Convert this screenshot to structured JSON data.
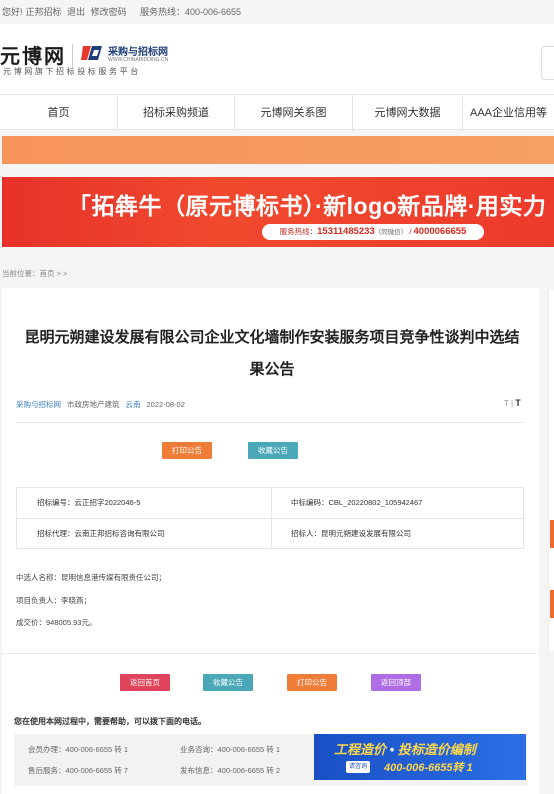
{
  "topbar": {
    "greeting": "您好!",
    "company": "正邦招标",
    "logout": "退出",
    "change_password": "修改密码",
    "hotline": "服务热线：400-006-6655"
  },
  "header": {
    "logo_text": "元博网",
    "logo_subtitle": "元博网旗下招标投标服务平台",
    "brand_name": "采购与招标网",
    "brand_url": "WWW.CHINABIDDING.CN"
  },
  "nav": {
    "items": [
      "首页",
      "招标采购频道",
      "元博网关系图",
      "元博网大数据",
      "AAA企业信用等"
    ]
  },
  "banner": {
    "title": "「拓犇牛（原元博标书）·新logo新品牌·用实力",
    "pill_prefix": "服务热线：",
    "pill_phone": "15311485233",
    "pill_note": "（同微信）",
    "pill_sep": " / ",
    "pill_phone2": "4000066655"
  },
  "breadcrumb": "当前位置：首页 > >",
  "article": {
    "title": "昆明元朔建设发展有限公司企业文化墙制作安装服务项目竞争性谈判中选结果公告",
    "category": "采购与招标网",
    "industry": "市政房地产建筑",
    "province": "云南",
    "date": "2022-08-02",
    "font_small": "T",
    "font_large": "T",
    "print_button": "打印公告",
    "collect_button": "收藏公告",
    "info": {
      "bid_no": "招标编号：云正招字2022046-5",
      "winning_code": "中标编码：CBL_20220802_105942467",
      "agent": "招标代理：云南正邦招标咨询有限公司",
      "tenderer": "招标人：昆明元朔建设发展有限公司"
    },
    "lines": [
      "中选人名称：昆明信息港传媒有限责任公司；",
      "项目负责人：李晓燕；",
      "成交价：948005.93元。"
    ],
    "bottom_buttons": {
      "home": "返回首页",
      "collect": "收藏公告",
      "print": "打印公告",
      "top": "返回顶部"
    }
  },
  "help": {
    "title": "您在使用本网过程中，需要帮助，可以拨下面的电话。",
    "member": "会员办理：400-006-6655 转 1",
    "business": "业务咨询：400-006-6655 转 1",
    "aftersale": "售后服务：400-006-6655 转 7",
    "publish": "发布信息：400-006-6655 转 2",
    "ad_title_1": "工程造价",
    "ad_dot": " • ",
    "ad_title_2": "投标造价编制",
    "ad_tag": "请咨询",
    "ad_phone": "400-006-6655转 1"
  },
  "colors": {
    "accent_orange": "#f07c3a",
    "accent_teal": "#4aa8b8",
    "banner_red": "#e8312a",
    "link_blue": "#3b7fbf"
  }
}
